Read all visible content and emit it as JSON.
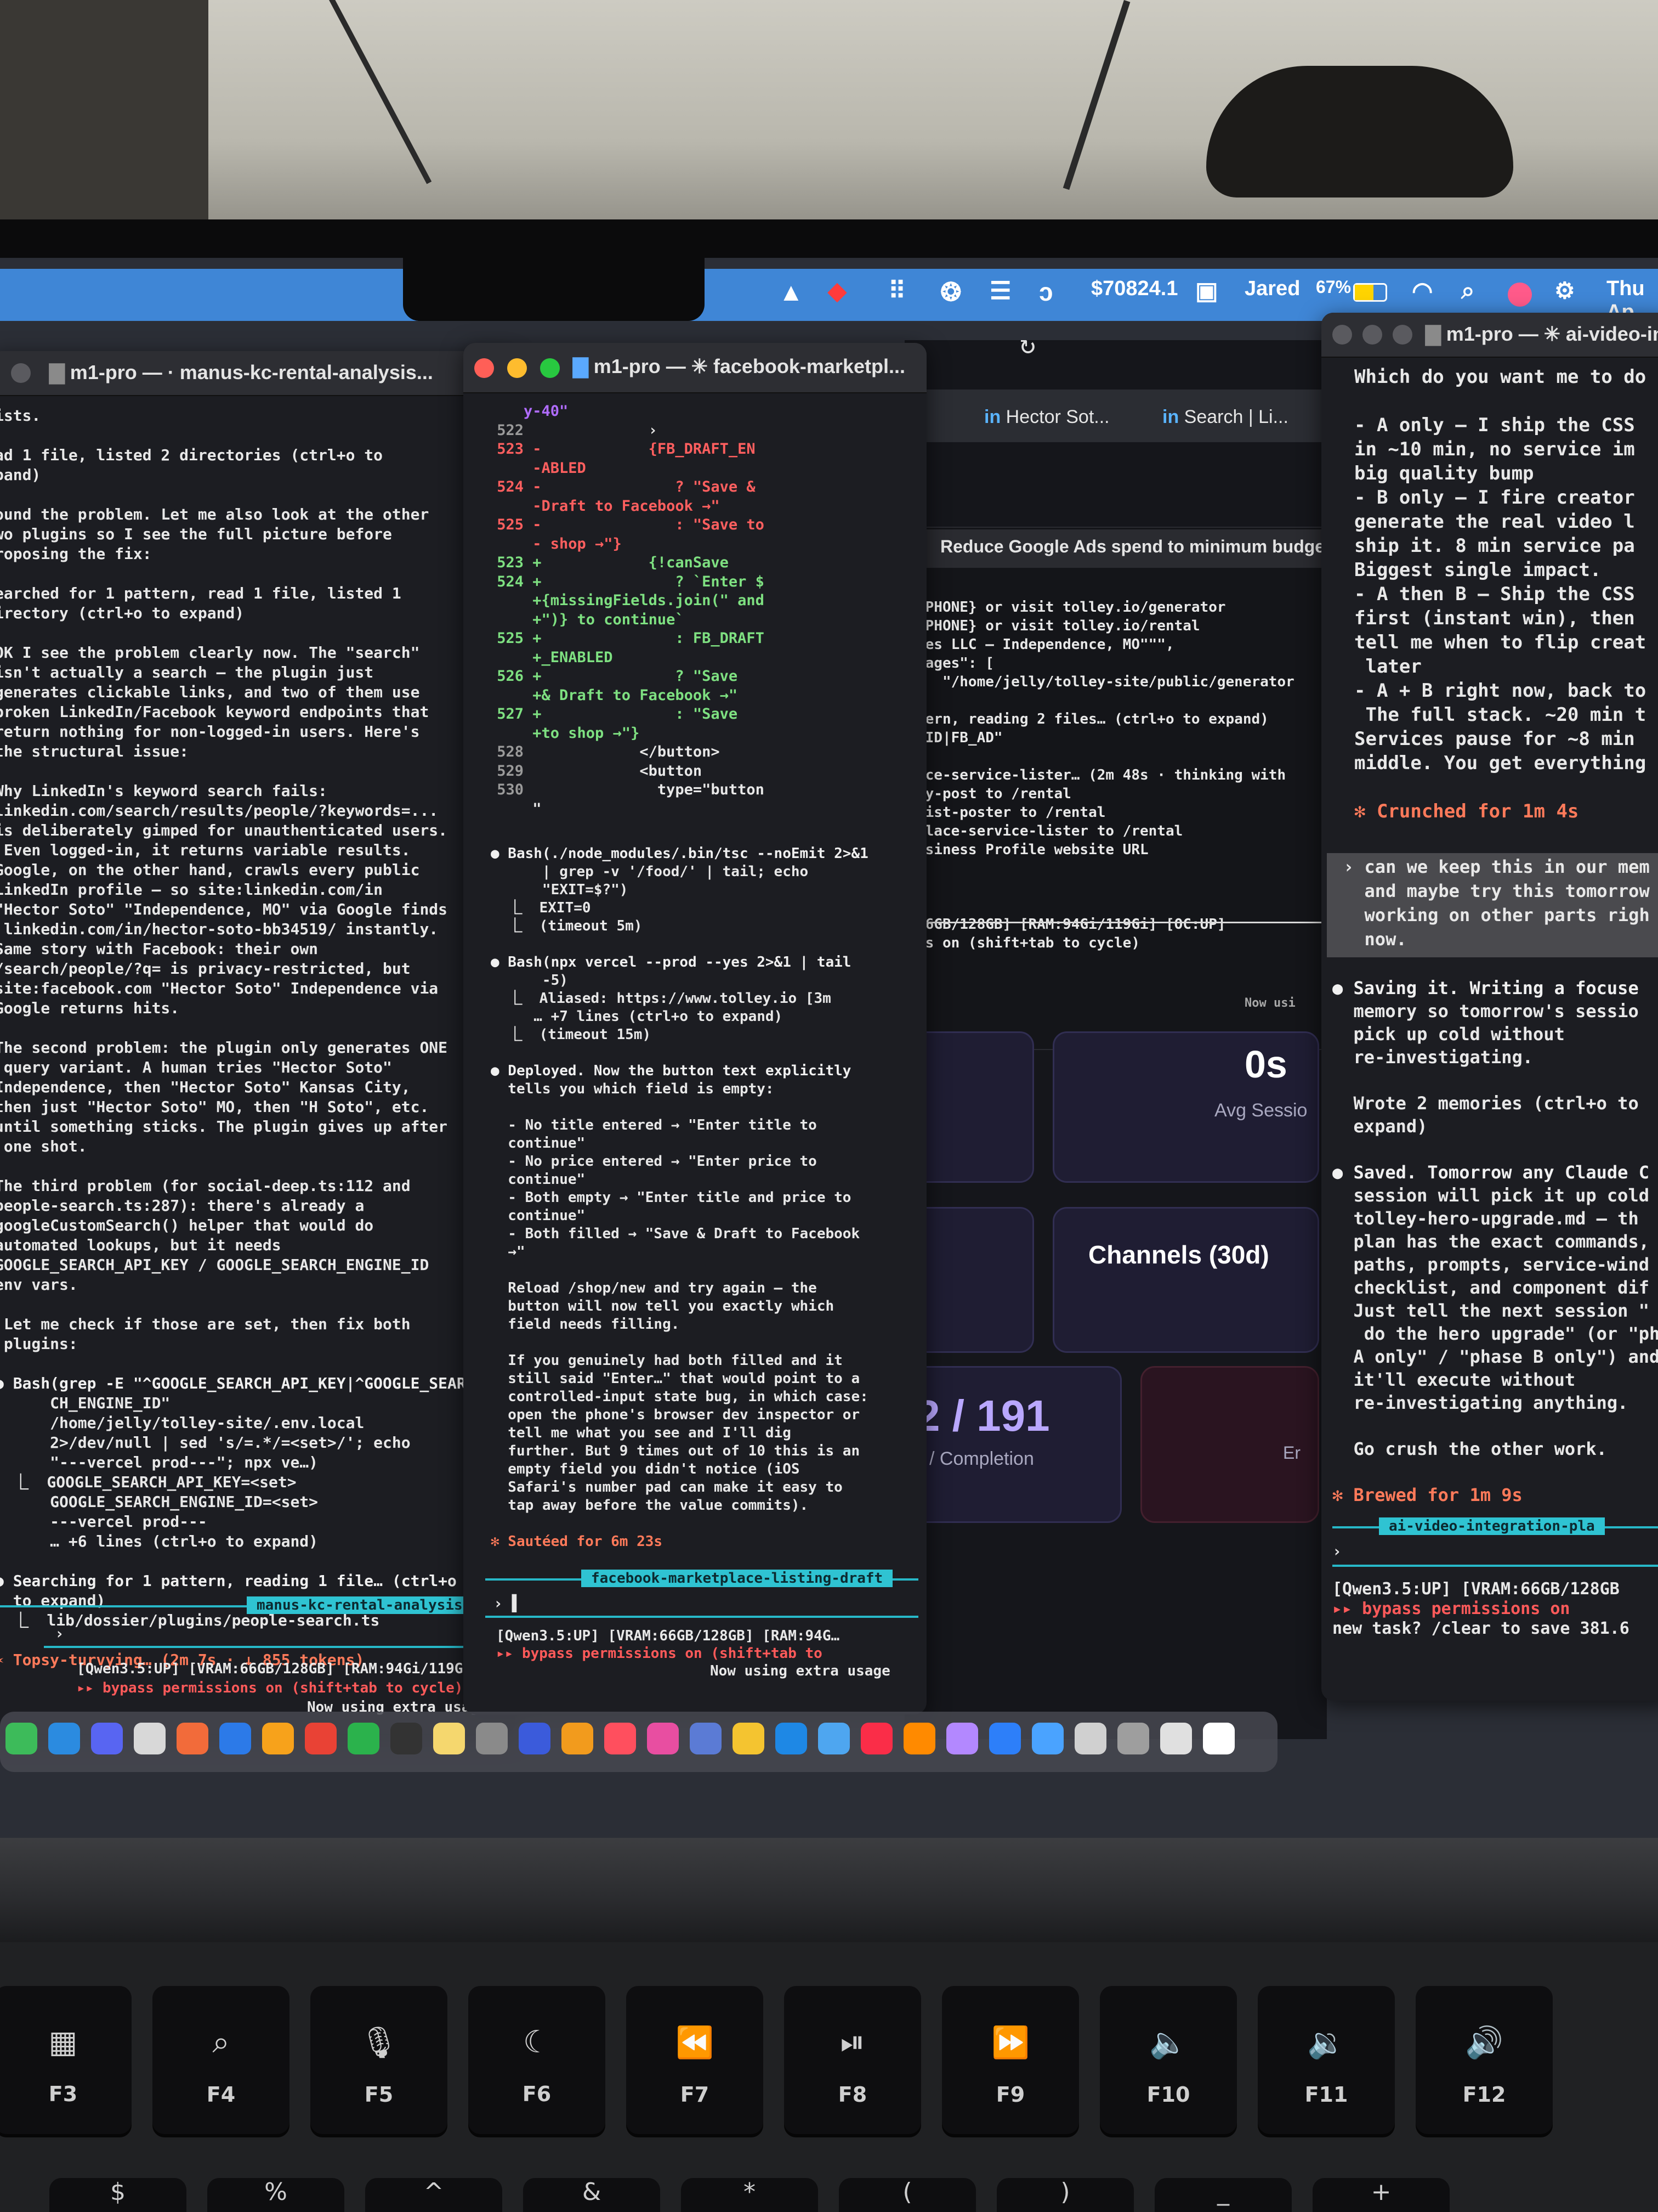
{
  "menubar": {
    "balance": "$70824.1",
    "user": "Jared",
    "battery": "67%",
    "date": "Thu Ap",
    "icons": [
      "vlc-icon",
      "alert-icon",
      "grid-icon",
      "chatgpt-icon",
      "layers-icon",
      "claude-icon",
      "window-icon",
      "wifi-icon",
      "search-icon",
      "siri-icon",
      "control-center-icon"
    ]
  },
  "win_left": {
    "title": "m1-pro — · manus-kc-rental-analysis...",
    "lines": [
      "ists.",
      "",
      "ad 1 file, listed 2 directories (ctrl+o to",
      "pand)",
      "",
      "ound the problem. Let me also look at the other",
      "wo plugins so I see the full picture before",
      "roposing the fix:",
      "",
      "earched for 1 pattern, read 1 file, listed 1",
      "irectory (ctrl+o to expand)",
      "",
      "OK I see the problem clearly now. The \"search\"",
      "isn't actually a search — the plugin just",
      "generates clickable links, and two of them use",
      "broken LinkedIn/Facebook keyword endpoints that",
      "return nothing for non-logged-in users. Here's",
      "the structural issue:",
      "",
      "Why LinkedIn's keyword search fails:",
      "linkedin.com/search/results/people/?keywords=...",
      "is deliberately gimped for unauthenticated users.",
      " Even logged-in, it returns variable results.",
      "Google, on the other hand, crawls every public",
      "LinkedIn profile — so site:linkedin.com/in",
      "\"Hector Soto\" \"Independence, MO\" via Google finds",
      " linkedin.com/in/hector-soto-bb34519/ instantly.",
      "Same story with Facebook: their own",
      "/search/people/?q= is privacy-restricted, but",
      "site:facebook.com \"Hector Soto\" Independence via",
      "Google returns hits.",
      "",
      "The second problem: the plugin only generates ONE",
      " query variant. A human tries \"Hector Soto\"",
      "Independence, then \"Hector Soto\" Kansas City,",
      "then just \"Hector Soto\" MO, then \"H Soto\", etc.",
      "until something sticks. The plugin gives up after",
      " one shot.",
      "",
      "The third problem (for social-deep.ts:112 and",
      "people-search.ts:287): there's already a",
      "googleCustomSearch() helper that would do",
      "automated lookups, but it needs",
      "GOOGLE_SEARCH_API_KEY / GOOGLE_SEARCH_ENGINE_ID",
      "env vars.",
      "",
      " Let me check if those are set, then fix both",
      " plugins:",
      "",
      "● Bash(grep -E \"^GOOGLE_SEARCH_API_KEY|^GOOGLE_SEAR",
      "      CH_ENGINE_ID\"",
      "      /home/jelly/tolley-site/.env.local",
      "      2>/dev/null | sed 's/=.*/=<set>/'; echo",
      "      \"---vercel prod---\"; npx ve…)",
      "  ⎿  GOOGLE_SEARCH_API_KEY=<set>",
      "      GOOGLE_SEARCH_ENGINE_ID=<set>",
      "      ---vercel prod---",
      "      … +6 lines (ctrl+o to expand)",
      "",
      "● Searching for 1 pattern, reading 1 file… (ctrl+o",
      "  to expand)",
      "  ⎿  lib/dossier/plugins/people-search.ts",
      "",
      "✶ Topsy-turvying… (2m 7s · ↓ 855 tokens)"
    ],
    "session_chip": "manus-kc-rental-analysis",
    "status1": "[Qwen3.5:UP] [VRAM:66GB/128GB] [RAM:94Gi/119Gi]…",
    "status2": "▸▸ bypass permissions on (shift+tab to cycle)",
    "status3": "Now using extra usage"
  },
  "win_mid": {
    "title": "m1-pro — ✳ facebook-marketpl...",
    "diff": [
      {
        "n": "",
        "t": "y-40\"",
        "c": "hl"
      },
      {
        "n": "522",
        "t": "              ›",
        "c": ""
      },
      {
        "n": "523",
        "t": " -            {FB_DRAFT_EN",
        "c": "del"
      },
      {
        "n": "",
        "t": " -ABLED",
        "c": "del"
      },
      {
        "n": "524",
        "t": " -               ? \"Save &",
        "c": "del"
      },
      {
        "n": "",
        "t": " -Draft to Facebook →\"",
        "c": "del"
      },
      {
        "n": "525",
        "t": " -               : \"Save to",
        "c": "del"
      },
      {
        "n": "",
        "t": " - shop →\"}",
        "c": "del"
      },
      {
        "n": "523",
        "t": " +            {!canSave",
        "c": "add"
      },
      {
        "n": "524",
        "t": " +               ? `Enter $",
        "c": "add"
      },
      {
        "n": "",
        "t": " +{missingFields.join(\" and",
        "c": "add"
      },
      {
        "n": "",
        "t": " +\")} to continue`",
        "c": "add"
      },
      {
        "n": "525",
        "t": " +               : FB_DRAFT",
        "c": "add"
      },
      {
        "n": "",
        "t": " +_ENABLED",
        "c": "add"
      },
      {
        "n": "526",
        "t": " +               ? \"Save",
        "c": "add"
      },
      {
        "n": "",
        "t": " +& Draft to Facebook →\"",
        "c": "add"
      },
      {
        "n": "527",
        "t": " +               : \"Save",
        "c": "add"
      },
      {
        "n": "",
        "t": " +to shop →\"}",
        "c": "add"
      },
      {
        "n": "528",
        "t": "             </button>",
        "c": ""
      },
      {
        "n": "529",
        "t": "             <button",
        "c": ""
      },
      {
        "n": "530",
        "t": "               type=\"button",
        "c": ""
      },
      {
        "n": "",
        "t": " \"",
        "c": ""
      }
    ],
    "lines": [
      "● Bash(./node_modules/.bin/tsc --noEmit 2>&1",
      "      | grep -v '/food/' | tail; echo",
      "      \"EXIT=$?\")",
      "  ⎿  EXIT=0",
      "  ⎿  (timeout 5m)",
      "",
      "● Bash(npx vercel --prod --yes 2>&1 | tail",
      "      -5)",
      "  ⎿  Aliased: https://www.tolley.io [3m",
      "     … +7 lines (ctrl+o to expand)",
      "  ⎿  (timeout 15m)",
      "",
      "● Deployed. Now the button text explicitly",
      "  tells you which field is empty:",
      "",
      "  - No title entered → \"Enter title to",
      "  continue\"",
      "  - No price entered → \"Enter price to",
      "  continue\"",
      "  - Both empty → \"Enter title and price to",
      "  continue\"",
      "  - Both filled → \"Save & Draft to Facebook",
      "  →\"",
      "",
      "  Reload /shop/new and try again — the",
      "  button will now tell you exactly which",
      "  field needs filling.",
      "",
      "  If you genuinely had both filled and it",
      "  still said \"Enter…\" that would point to a",
      "  controlled-input state bug, in which case:",
      "  open the phone's browser dev inspector or",
      "  tell me what you see and I'll dig",
      "  further. But 9 times out of 10 this is an",
      "  empty field you didn't notice (iOS",
      "  Safari's number pad can make it easy to",
      "  tap away before the value commits).",
      "",
      "✻ Sautéed for 6m 23s"
    ],
    "session_chip": "facebook-marketplace-listing-draft",
    "status1": "[Qwen3.5:UP] [VRAM:66GB/128GB] [RAM:94G…",
    "status2": "▸▸ bypass permissions on (shift+tab to",
    "status3": "Now using extra usage"
  },
  "browser": {
    "tabs": [
      "Hector Sot...",
      "Search | Li..."
    ],
    "overlay_title": "Reduce Google Ads spend to minimum budge",
    "overlay_lines": [
      "{PHONE} or visit tolley.io/generator",
      "{PHONE} or visit tolley.io/rental",
      "mes LLC — Independence, MO\"\"\",",
      "mages\": [",
      "   \"/home/jelly/tolley-site/public/generator",
      "",
      "tern, reading 2 files… (ctrl+o to expand)",
      "_ID|FB_AD\"",
      "",
      "ace-service-lister… (2m 48s · thinking with",
      "ly-post to /rental",
      "list-poster to /rental",
      "place-service-lister to /rental",
      "usiness Profile website URL",
      "",
      "",
      "",
      "66GB/128GB] [RAM:94Gi/119Gi] [OC:UP]",
      "ns on (shift+tab to cycle)"
    ],
    "overlay_extra": "Now usi",
    "stat_value": "0s",
    "stat_label": "Avg Sessio",
    "channels": "Channels (30d)",
    "completion_value": "2 / 191",
    "completion_label": "/ Completion",
    "err_label": "Er"
  },
  "win_right": {
    "title": "m1-pro — ✳ ai-video-in",
    "lines": [
      "Which do you want me to do",
      "",
      "- A only — I ship the CSS",
      "in ~10 min, no service im",
      "big quality bump",
      "- B only — I fire creator",
      "generate the real video l",
      "ship it. 8 min service pa",
      "Biggest single impact.",
      "- A then B — Ship the CSS",
      "first (instant win), then",
      "tell me when to flip creat",
      " later",
      "- A + B right now, back to",
      " The full stack. ~20 min t",
      "Services pause for ~8 min",
      "middle. You get everything",
      "",
      "✻ Crunched for 1m 4s"
    ],
    "prompt_lines": [
      "› can we keep this in our mem",
      "  and maybe try this tomorrow",
      "  working on other parts righ",
      "  now."
    ],
    "lines2": [
      "● Saving it. Writing a focuse",
      "  memory so tomorrow's sessio",
      "  pick up cold without",
      "  re-investigating.",
      "",
      "  Wrote 2 memories (ctrl+o to",
      "  expand)",
      "",
      "● Saved. Tomorrow any Claude C",
      "  session will pick it up cold",
      "  tolley-hero-upgrade.md — th",
      "  plan has the exact commands,",
      "  paths, prompts, service-wind",
      "  checklist, and component dif",
      "  Just tell the next session \"",
      "   do the hero upgrade\" (or \"ph",
      "  A only\" / \"phase B only\") and",
      "  it'll execute without",
      "  re-investigating anything.",
      "",
      "  Go crush the other work.",
      "",
      "✻ Brewed for 1m 9s"
    ],
    "session_chip": "ai-video-integration-pla",
    "status1": "[Qwen3.5:UP] [VRAM:66GB/128GB",
    "status2": "▸▸ bypass permissions on",
    "status3": "new task? /clear to save 381.6"
  },
  "keys": [
    {
      "icon": "▦",
      "label": "F3"
    },
    {
      "icon": "⌕",
      "label": "F4"
    },
    {
      "icon": "🎙",
      "label": "F5"
    },
    {
      "icon": "☾",
      "label": "F6"
    },
    {
      "icon": "⏪",
      "label": "F7"
    },
    {
      "icon": "⏯",
      "label": "F8"
    },
    {
      "icon": "⏩",
      "label": "F9"
    },
    {
      "icon": "🔈",
      "label": "F10"
    },
    {
      "icon": "🔉",
      "label": "F11"
    },
    {
      "icon": "🔊",
      "label": "F12"
    }
  ],
  "num_keys": [
    "$",
    "%",
    "^",
    "&",
    "*",
    "(",
    ")",
    "_",
    "+"
  ],
  "dock_colors": [
    "#3dbb5a",
    "#2b8be0",
    "#5865f2",
    "#d8d8d8",
    "#f26b3a",
    "#2c7ae8",
    "#f7a21b",
    "#e94235",
    "#2bb24c",
    "#333333",
    "#f5d76e",
    "#8a8a8a",
    "#3b5bdb",
    "#f29b1d",
    "#ff4f5e",
    "#e84ea1",
    "#5b7bd5",
    "#f4c430",
    "#1e88e5",
    "#4ea6f0",
    "#fa2d48",
    "#ff8a00",
    "#b388ff",
    "#2d7ff9",
    "#4aa3ff",
    "#d0d0d0",
    "#9e9e9e",
    "#e0e0e0",
    "#ffffff"
  ]
}
